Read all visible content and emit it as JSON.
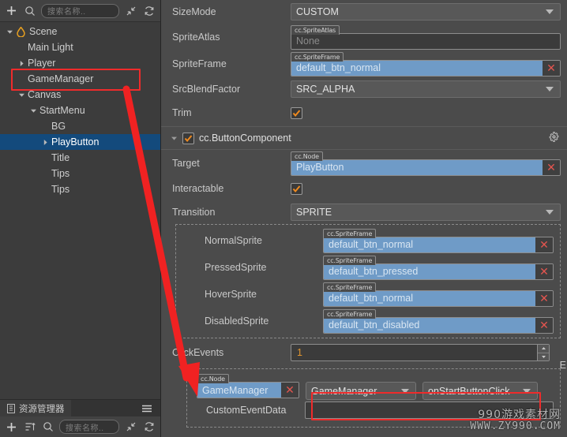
{
  "app": {
    "theme_bg": "#3c3c3c",
    "accent_blue": "#6f9bc7",
    "accent_orange": "#e0952f",
    "highlight_red": "#ef2b2b"
  },
  "hierarchy_panel": {
    "toolbar": {
      "add_icon": "plus-icon",
      "search_icon": "search-icon",
      "search_placeholder": "搜索名称..",
      "collapse_icon": "collapse-icon",
      "refresh_icon": "refresh-icon"
    },
    "tree": [
      {
        "label": "Scene",
        "depth": 0,
        "arrow": "down",
        "icon": "scene-flame-icon",
        "selected": false
      },
      {
        "label": "Main Light",
        "depth": 1,
        "arrow": "none",
        "icon": "",
        "selected": false
      },
      {
        "label": "Player",
        "depth": 1,
        "arrow": "right",
        "icon": "",
        "selected": false
      },
      {
        "label": "GameManager",
        "depth": 1,
        "arrow": "none",
        "icon": "",
        "selected": false
      },
      {
        "label": "Canvas",
        "depth": 1,
        "arrow": "down",
        "icon": "",
        "selected": false
      },
      {
        "label": "StartMenu",
        "depth": 2,
        "arrow": "down",
        "icon": "",
        "selected": false
      },
      {
        "label": "BG",
        "depth": 3,
        "arrow": "none",
        "icon": "",
        "selected": false
      },
      {
        "label": "PlayButton",
        "depth": 3,
        "arrow": "right",
        "icon": "",
        "selected": true
      },
      {
        "label": "Title",
        "depth": 3,
        "arrow": "none",
        "icon": "",
        "selected": false
      },
      {
        "label": "Tips",
        "depth": 3,
        "arrow": "none",
        "icon": "",
        "selected": false
      },
      {
        "label": "Tips",
        "depth": 3,
        "arrow": "none",
        "icon": "",
        "selected": false
      }
    ],
    "bottom_tab": {
      "label": "资源管理器",
      "tab_icon": "assets-panel-icon",
      "menu_icon": "hamburger-menu-icon"
    },
    "bottom_toolbar": {
      "add_icon": "plus-icon",
      "sort_icon": "sort-icon",
      "search_icon": "search-icon",
      "search_placeholder": "搜索名称..",
      "expand_icon": "expand-icon",
      "refresh_icon": "refresh-icon"
    }
  },
  "inspector": {
    "sprite_rows": [
      {
        "label": "SizeMode",
        "kind": "combo",
        "value": "CUSTOM"
      },
      {
        "label": "SpriteAtlas",
        "kind": "asset",
        "type_tag": "cc.SpriteAtlas",
        "value": "None",
        "empty": true
      },
      {
        "label": "SpriteFrame",
        "kind": "asset",
        "type_tag": "cc.SpriteFrame",
        "value": "default_btn_normal",
        "empty": false
      },
      {
        "label": "SrcBlendFactor",
        "kind": "combo",
        "value": "SRC_ALPHA"
      },
      {
        "label": "Trim",
        "kind": "check",
        "value": true
      }
    ],
    "button_component": {
      "title": "cc.ButtonComponent",
      "enabled": true,
      "expanded": true,
      "gear_icon": "gear-icon",
      "rows": [
        {
          "label": "Target",
          "kind": "asset",
          "type_tag": "cc.Node",
          "value": "PlayButton"
        },
        {
          "label": "Interactable",
          "kind": "check",
          "value": true
        },
        {
          "label": "Transition",
          "kind": "combo",
          "value": "SPRITE"
        }
      ],
      "sprite_states": [
        {
          "label": "NormalSprite",
          "type_tag": "cc.SpriteFrame",
          "value": "default_btn_normal"
        },
        {
          "label": "PressedSprite",
          "type_tag": "cc.SpriteFrame",
          "value": "default_btn_pressed"
        },
        {
          "label": "HoverSprite",
          "type_tag": "cc.SpriteFrame",
          "value": "default_btn_normal"
        },
        {
          "label": "DisabledSprite",
          "type_tag": "cc.SpriteFrame",
          "value": "default_btn_disabled"
        }
      ],
      "click_events": {
        "label": "ClickEvents",
        "count": "1",
        "edge_letter": "E",
        "entry": {
          "node_type_tag": "cc.Node",
          "node_value": "GameManager",
          "component_dropdown": "GameManager",
          "handler_dropdown": "onStartButtonClick",
          "custom_event_data_label": "CustomEventData",
          "custom_event_data_value": ""
        }
      }
    }
  },
  "annotations": {
    "watermark_line1": "990游戏素材网",
    "watermark_line2": "WWW.ZY990.COM",
    "highlight_boxes": [
      {
        "name": "gamemanager-node-highlight"
      },
      {
        "name": "gamemanager-target-highlight"
      },
      {
        "name": "event-dropdowns-highlight"
      }
    ],
    "arrow": {
      "name": "red-pointer-arrow"
    }
  }
}
